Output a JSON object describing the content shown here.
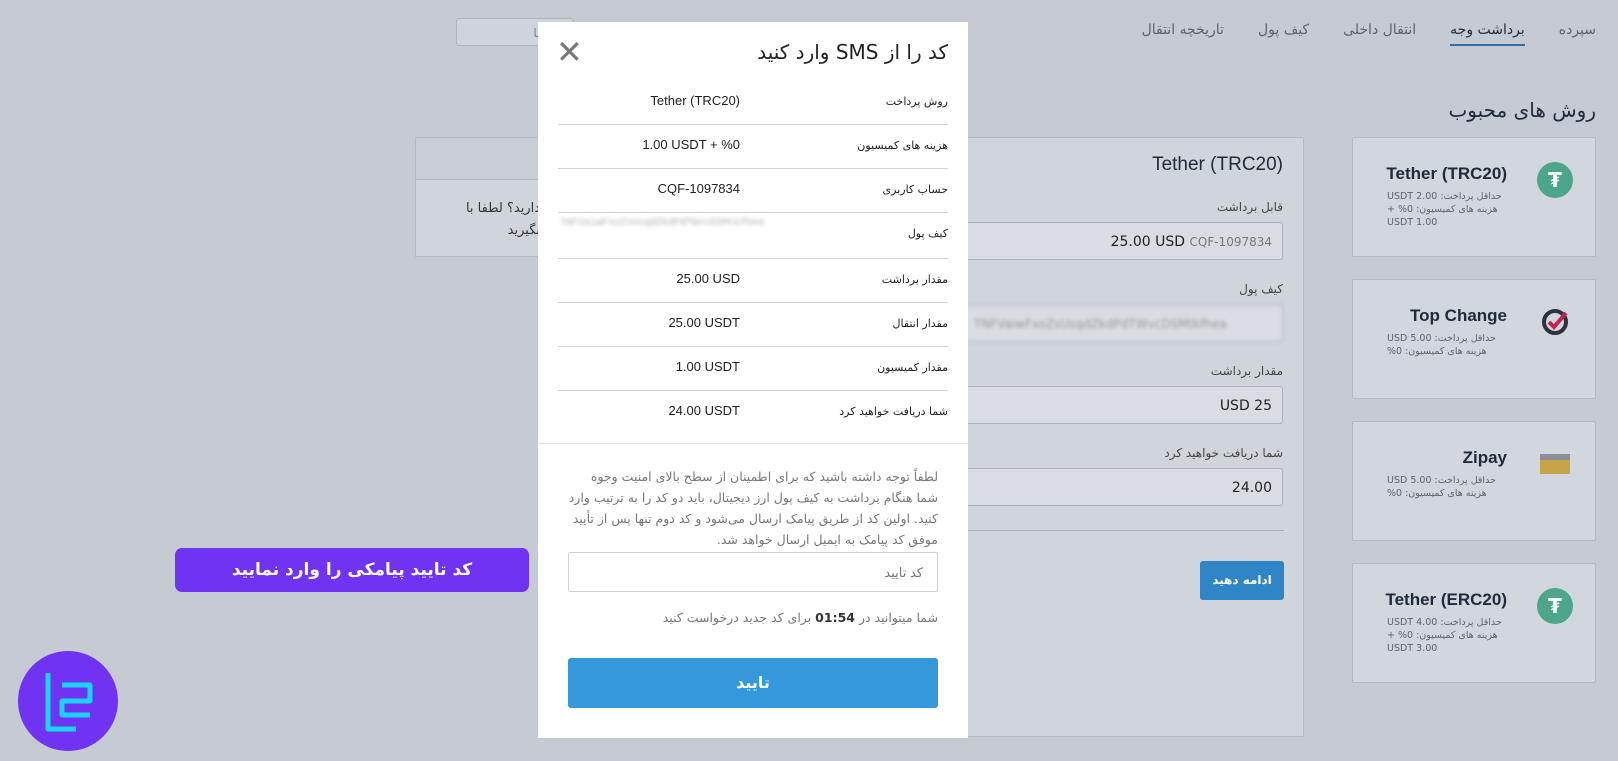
{
  "nav": {
    "tabs": [
      {
        "label": "سپرده"
      },
      {
        "label": "برداشت وجه"
      },
      {
        "label": "انتقال داخلی"
      },
      {
        "label": "کیف پول"
      },
      {
        "label": "تاریخچه انتقال"
      }
    ],
    "help_label": "راهنما"
  },
  "section_title": "روش های محبوب",
  "methods": [
    {
      "name": "Tether (TRC20)",
      "icon": "tether-icon",
      "details": [
        "حداقل پرداخت: 2.00 USDT",
        "هزینه های کمیسیون: 0% +",
        "1.00 USDT"
      ],
      "color": "#4ca68a"
    },
    {
      "name": "Top Change",
      "icon": "topchange-icon",
      "details": [
        "حداقل پرداخت: 5.00 USD",
        "هزینه های کمیسیون: 0%"
      ],
      "color": "#2b3340"
    },
    {
      "name": "Zipay",
      "icon": "zipay-icon",
      "details": [
        "حداقل پرداخت: 5.00 USD",
        "هزینه های کمیسیون: 0%"
      ],
      "color": "#c8a449"
    },
    {
      "name": "Tether (ERC20)",
      "icon": "tether-icon",
      "details": [
        "حداقل پرداخت: 4.00 USDT",
        "هزینه های کمیسیون: 0% +",
        "3.00 USDT"
      ],
      "color": "#4ca68a"
    }
  ],
  "form": {
    "title": "Tether (TRC20)",
    "withdrawable_label": "قابل برداشت",
    "withdrawable_account": "CQF-1097834",
    "withdrawable_value": "25.00 USD",
    "wallet_label": "کیف پول",
    "wallet_value": "TNFVaiwFxoZsUsqdZkdPdTWvcDSMtkfhea",
    "amount_label": "مقدار برداشت",
    "amount_value": "USD 25",
    "receive_label": "شما دریافت خواهید کرد",
    "receive_value": "24.00",
    "continue_label": "ادامه دهید"
  },
  "side_card": {
    "line1": "دارید؟ لطفا با",
    "line2": "بگیرید"
  },
  "modal": {
    "title": "کد را از SMS وارد کنید",
    "rows": [
      {
        "label": "روش پرداخت",
        "value": "Tether (TRC20)"
      },
      {
        "label": "هزینه های کمیسیون",
        "value": "1.00 USDT + %0"
      },
      {
        "label": "حساب کاربری",
        "value": "CQF-1097834"
      },
      {
        "label": "کیف پول",
        "value": "TNFVaiwFxoZsUsqdZkdPdTWvcDSMtkfhea"
      },
      {
        "label": "مقدار برداشت",
        "value": "25.00 USD"
      },
      {
        "label": "مقدار انتقال",
        "value": "25.00 USDT"
      },
      {
        "label": "مقدار کمیسیون",
        "value": "1.00 USDT"
      },
      {
        "label": "شما دریافت خواهید کرد",
        "value": "24.00 USDT"
      }
    ],
    "notice": "لطفاً توجه داشته باشید که برای اطمینان از سطح بالای امنیت وجوه شما هنگام برداشت به کیف پول ارز دیجیتال، باید دو کد را به ترتیب وارد کنید. اولین کد از طریق پیامک ارسال می‌شود و کد دوم تنها پس از تأیید موفق کد پیامک به ایمیل ارسال خواهد شد.",
    "code_placeholder": "کد تایید",
    "timer_prefix": "شما میتوانید در",
    "timer_value": "01:54",
    "timer_suffix": "برای کد جدید درخواست کنید",
    "confirm_label": "تایید"
  },
  "banner": "کد تایید پیامکی را وارد نمایید"
}
